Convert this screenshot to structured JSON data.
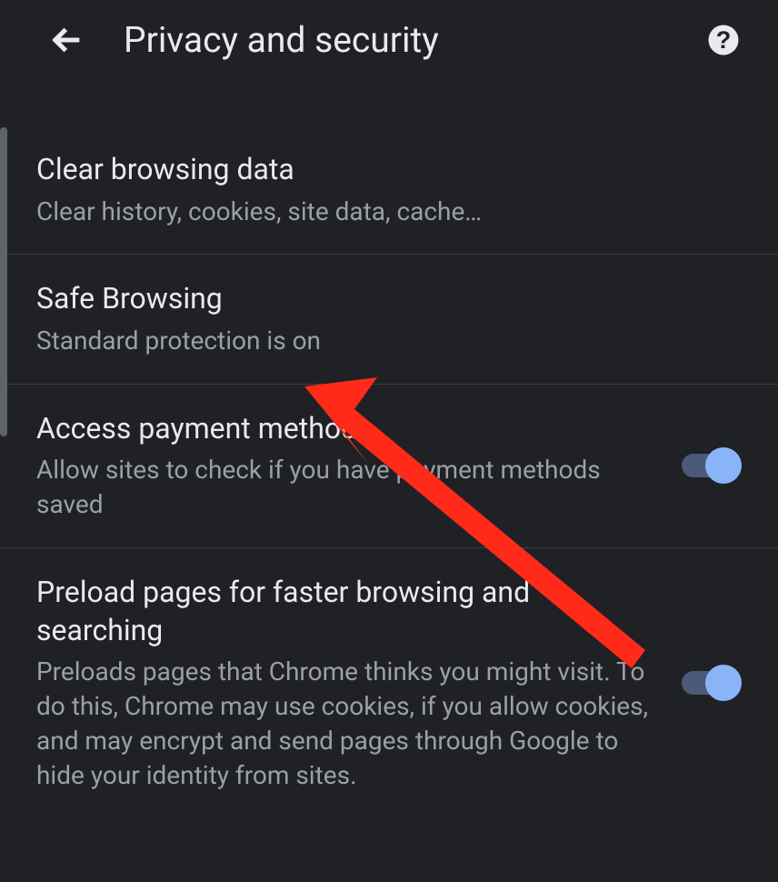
{
  "header": {
    "title": "Privacy and security"
  },
  "items": [
    {
      "title": "Clear browsing data",
      "subtitle": "Clear history, cookies, site data, cache…"
    },
    {
      "title": "Safe Browsing",
      "subtitle": "Standard protection is on"
    },
    {
      "title": "Access payment methods",
      "subtitle": "Allow sites to check if you have payment methods saved"
    },
    {
      "title": "Preload pages for faster browsing and searching",
      "subtitle": "Preloads pages that Chrome thinks you might visit. To do this, Chrome may use cookies, if you allow cookies, and may encrypt and send pages through Google to hide your identity from sites."
    }
  ]
}
